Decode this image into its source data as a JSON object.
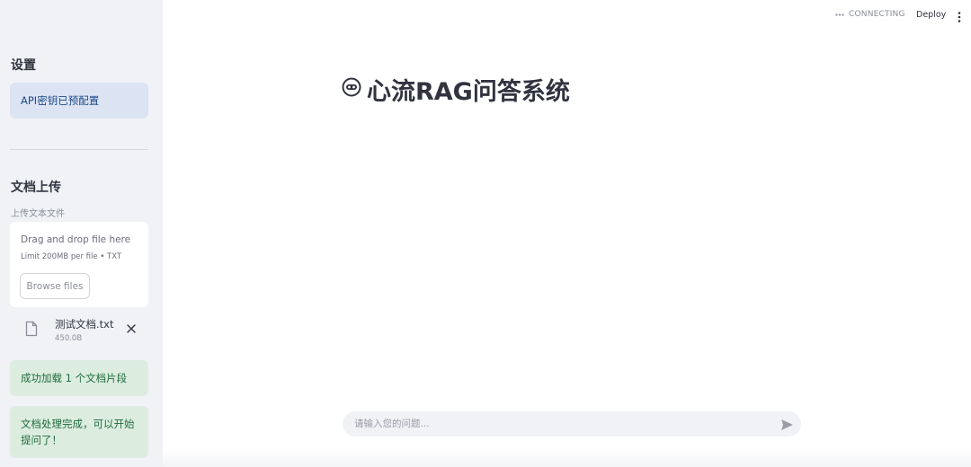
{
  "header": {
    "status_text": "CONNECTING",
    "deploy_label": "Deploy"
  },
  "sidebar": {
    "settings_heading": "设置",
    "api_key_notice": "API密钥已预配置",
    "upload_heading": "文档上传",
    "uploader_label": "上传文本文件",
    "dropzone": {
      "title": "Drag and drop file here",
      "limit": "Limit 200MB per file • TXT",
      "browse_label": "Browse files"
    },
    "uploaded_file": {
      "name": "测试文档.txt",
      "size": "450.0B"
    },
    "success_messages": [
      "成功加载 1 个文档片段",
      "文档处理完成，可以开始提问了！"
    ]
  },
  "main": {
    "title": "心流RAG问答系统",
    "title_icon": "robot-face-icon"
  },
  "chat": {
    "placeholder": "请输入您的问题..."
  },
  "colors": {
    "sidebar_bg": "#f0f2f6",
    "info_bg": "#dce4f3",
    "info_text": "#1e4a8a",
    "success_bg": "#dcede0",
    "success_text": "#1f6b3c",
    "text": "#31333f"
  }
}
